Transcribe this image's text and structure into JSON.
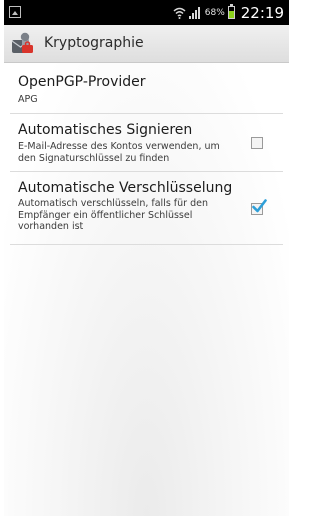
{
  "status_bar": {
    "battery_percent": "68%",
    "battery_level": 0.68,
    "time": "22:19"
  },
  "action_bar": {
    "title": "Kryptographie"
  },
  "preferences": [
    {
      "title": "OpenPGP-Provider",
      "summary": "APG"
    },
    {
      "title": "Automatisches Signieren",
      "summary": "E-Mail-Adresse des Kontos verwenden, um den Signaturschlüssel zu finden",
      "checked": false
    },
    {
      "title": "Automatische Verschlüsselung",
      "summary": "Automatisch verschlüsseln, falls für den Empfänger ein öffentlicher Schlüssel vorhanden ist",
      "checked": true
    }
  ],
  "colors": {
    "checkmark": "#2e9fd8",
    "battery_fill": "#8ad11a"
  }
}
